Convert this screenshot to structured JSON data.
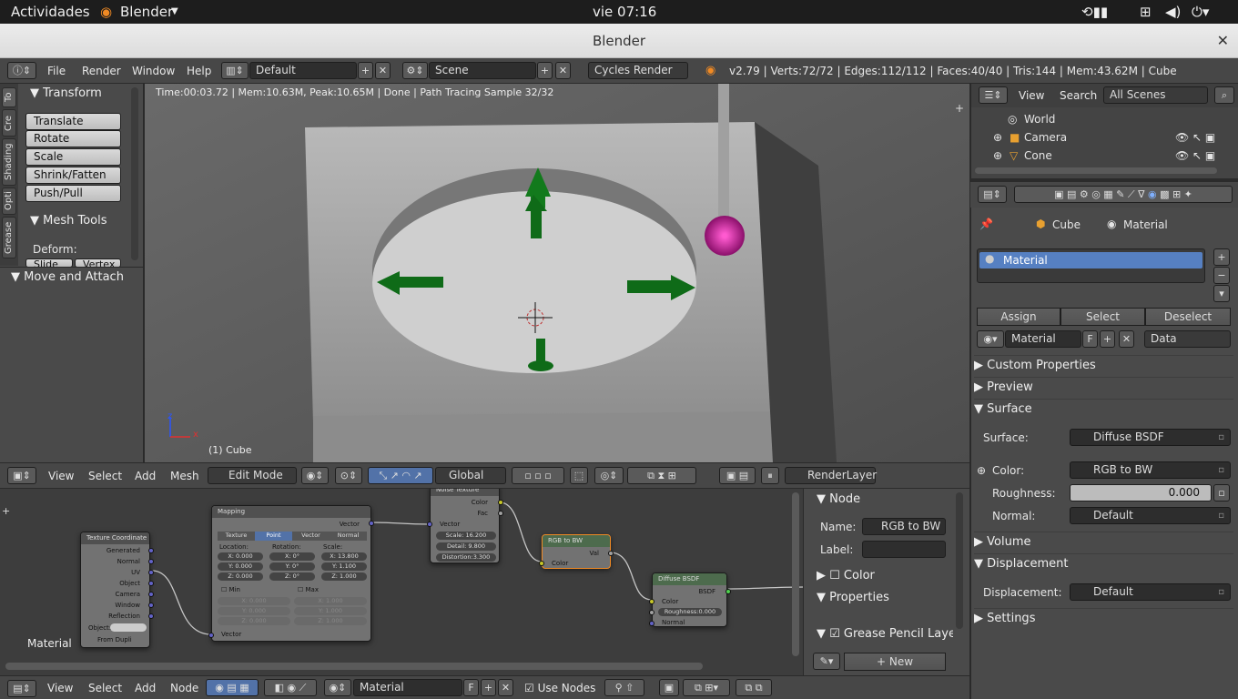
{
  "gnome": {
    "activities": "Actividades",
    "app": "Blender",
    "clock": "vie 07:16"
  },
  "window": {
    "title": "Blender"
  },
  "info_header": {
    "menus": [
      "File",
      "Render",
      "Window",
      "Help"
    ],
    "layout": "Default",
    "scene": "Scene",
    "engine": "Cycles Render",
    "stats": "v2.79 | Verts:72/72 | Edges:112/112 | Faces:40/40 | Tris:144 | Mem:43.62M | Cube"
  },
  "shelf": {
    "tabs": [
      "To",
      "Cre",
      "Shading",
      "Opti",
      "Grease"
    ],
    "transform_title": "Transform",
    "transform_buttons": [
      "Translate",
      "Rotate",
      "Scale",
      "Shrink/Fatten",
      "Push/Pull"
    ],
    "mesh_tools_title": "Mesh Tools",
    "deform_label": "Deform:",
    "partial_buttons": [
      "Slide Ed",
      "Vertex"
    ],
    "move_attach_title": "Move and Attach"
  },
  "viewport": {
    "render_status": "Time:00:03.72 | Mem:10.63M, Peak:10.65M | Done | Path Tracing Sample 32/32",
    "object_label": "(1) Cube",
    "axis_x": "x",
    "axis_z": "z"
  },
  "header3d": {
    "menus": [
      "View",
      "Select",
      "Add",
      "Mesh"
    ],
    "mode": "Edit Mode",
    "orientation": "Global",
    "render_layer": "RenderLayer"
  },
  "node_editor": {
    "material_label": "Material",
    "texcoord": {
      "title": "Texture Coordinate",
      "outputs": [
        "Generated",
        "Normal",
        "UV",
        "Object",
        "Camera",
        "Window",
        "Reflection"
      ],
      "object_label": "Object:",
      "from_dupli": "From Dupli"
    },
    "mapping": {
      "title": "Mapping",
      "output": "Vector",
      "tabs": [
        "Texture",
        "Point",
        "Vector",
        "Normal"
      ],
      "location_label": "Location:",
      "rotation_label": "Rotation:",
      "scale_label": "Scale:",
      "loc": [
        "X:   0.000",
        "Y:   0.000",
        "Z:   0.000"
      ],
      "rot": [
        "X:       0°",
        "Y:       0°",
        "Z:       0°"
      ],
      "scale": [
        "X:  13.800",
        "Y:   1.100",
        "Z:   1.000"
      ],
      "min_label": "Min",
      "max_label": "Max",
      "min": [
        "X:      0.000",
        "Y:      0.000",
        "Z:      0.000"
      ],
      "max": [
        "X:      1.000",
        "Y:      1.000",
        "Z:      1.000"
      ],
      "input": "Vector"
    },
    "noise": {
      "title": "Noise Texture",
      "outputs": [
        "Color",
        "Fac"
      ],
      "input": "Vector",
      "fields": [
        "Scale:    16.200",
        "Detail:    9.800",
        "Distortion:3.300"
      ]
    },
    "rgbbw": {
      "title": "RGB to BW",
      "output": "Val",
      "input": "Color"
    },
    "diffuse": {
      "title": "Diffuse BSDF",
      "output": "BSDF",
      "inputs": [
        "Color",
        "Roughness:0.000",
        "Normal"
      ]
    }
  },
  "node_panel": {
    "node_title": "Node",
    "name_label": "Name:",
    "name_value": "RGB to BW",
    "label_label": "Label:",
    "label_value": "",
    "color_title": "Color",
    "properties_title": "Properties",
    "grease_title": "Grease Pencil Layers",
    "new_button": "New"
  },
  "node_header": {
    "menus": [
      "View",
      "Select",
      "Add",
      "Node"
    ],
    "material": "Material",
    "fake_user": "F",
    "use_nodes": "Use Nodes"
  },
  "outliner": {
    "menus": [
      "View",
      "Search"
    ],
    "filter": "All Scenes",
    "items": [
      "World",
      "Camera",
      "Cone"
    ]
  },
  "properties": {
    "breadcrumb": [
      "Cube",
      "Material"
    ],
    "slot": "Material",
    "buttons": [
      "Assign",
      "Select",
      "Deselect"
    ],
    "material_name": "Material",
    "fake_user": "F",
    "link": "Data",
    "sections": {
      "custom": "Custom Properties",
      "preview": "Preview",
      "surface": "Surface",
      "volume": "Volume",
      "displacement": "Displacement",
      "settings": "Settings"
    },
    "surface_label": "Surface:",
    "surface_value": "Diffuse BSDF",
    "color_label": "Color:",
    "color_value": "RGB to BW",
    "roughness_label": "Roughness:",
    "roughness_value": "0.000",
    "normal_label": "Normal:",
    "normal_value": "Default",
    "displacement_label": "Displacement:",
    "displacement_value": "Default"
  }
}
